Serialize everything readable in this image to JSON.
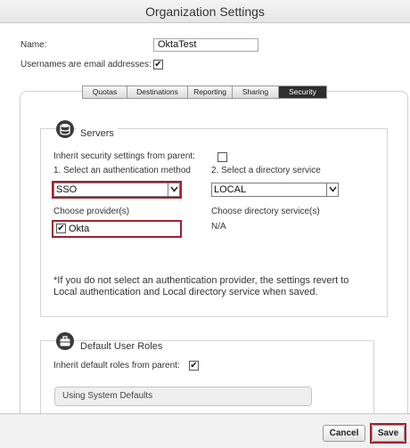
{
  "window": {
    "title": "Organization Settings"
  },
  "general": {
    "name_label": "Name:",
    "name_value": "OktaTest",
    "usernames_email_label": "Usernames are email addresses:",
    "usernames_email_checked": true
  },
  "tabs": [
    {
      "label": "Quotas",
      "active": false
    },
    {
      "label": "Destinations",
      "active": false
    },
    {
      "label": "Reporting",
      "active": false
    },
    {
      "label": "Sharing",
      "active": false
    },
    {
      "label": "Security",
      "active": true
    }
  ],
  "servers": {
    "title": "Servers",
    "icon": "database-icon",
    "inherit_label": "Inherit security settings from parent:",
    "inherit_checked": false,
    "auth_method_label": "1. Select an authentication method",
    "auth_method_value": "SSO",
    "directory_service_label": "2. Select a directory service",
    "directory_service_value": "LOCAL",
    "provider_label": "Choose provider(s)",
    "provider_option": "Okta",
    "provider_checked": true,
    "directory_services_label": "Choose directory service(s)",
    "directory_services_value": "N/A",
    "note": "*If you do not select an authentication provider, the settings revert to Local authentication and Local directory service when saved."
  },
  "default_roles": {
    "title": "Default User Roles",
    "icon": "briefcase-icon",
    "inherit_label": "Inherit default roles from parent:",
    "inherit_checked": true,
    "system_defaults_label": "Using System Defaults"
  },
  "footer": {
    "cancel_label": "Cancel",
    "save_label": "Save"
  },
  "colors": {
    "highlight": "#a3202d",
    "active_tab": "#2e2e2e"
  }
}
